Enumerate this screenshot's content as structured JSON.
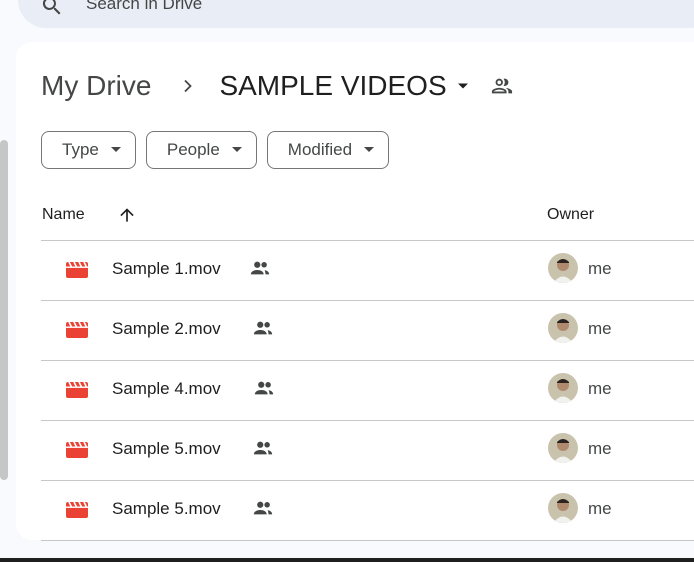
{
  "search": {
    "placeholder": "Search in Drive"
  },
  "breadcrumb": {
    "root": "My Drive",
    "current": "SAMPLE VIDEOS"
  },
  "filters": [
    {
      "label": "Type"
    },
    {
      "label": "People"
    },
    {
      "label": "Modified"
    }
  ],
  "columns": {
    "name": "Name",
    "owner": "Owner"
  },
  "files": [
    {
      "name": "Sample 1.mov",
      "owner": "me"
    },
    {
      "name": "Sample 2.mov",
      "owner": "me"
    },
    {
      "name": "Sample 4.mov",
      "owner": "me"
    },
    {
      "name": "Sample 5.mov",
      "owner": "me"
    },
    {
      "name": "Sample 5.mov",
      "owner": "me"
    }
  ],
  "colors": {
    "video_icon": "#ea4335",
    "panel_bg": "#ffffff",
    "page_bg": "#f8fafd",
    "divider": "#c7c7c7"
  }
}
